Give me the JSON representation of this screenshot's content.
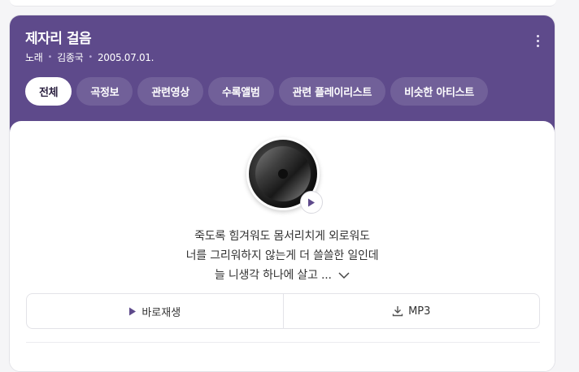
{
  "accent_color": "#5e4a8b",
  "song": {
    "title": "제자리 걸음",
    "meta": [
      "노래",
      "김종국",
      "2005.07.01."
    ]
  },
  "tabs": [
    {
      "label": "전체",
      "active": true
    },
    {
      "label": "곡정보",
      "active": false
    },
    {
      "label": "관련영상",
      "active": false
    },
    {
      "label": "수록앨범",
      "active": false
    },
    {
      "label": "관련 플레이리스트",
      "active": false
    },
    {
      "label": "비슷한 아티스트",
      "active": false
    }
  ],
  "lyrics": {
    "lines": [
      "죽도록 힘겨워도 몸서리치게 외로워도",
      "너를 그리워하지 않는게 더 쓸쓸한 일인데",
      "늘 니생각 하나에 살고 ..."
    ],
    "expand_icon": "chevron-down-icon"
  },
  "actions": {
    "play_label": "바로재생",
    "play_icon": "play-icon",
    "mp3_label": "MP3",
    "mp3_icon": "download-icon"
  },
  "icons": {
    "more": "more-vertical-icon",
    "album_play": "play-icon"
  }
}
